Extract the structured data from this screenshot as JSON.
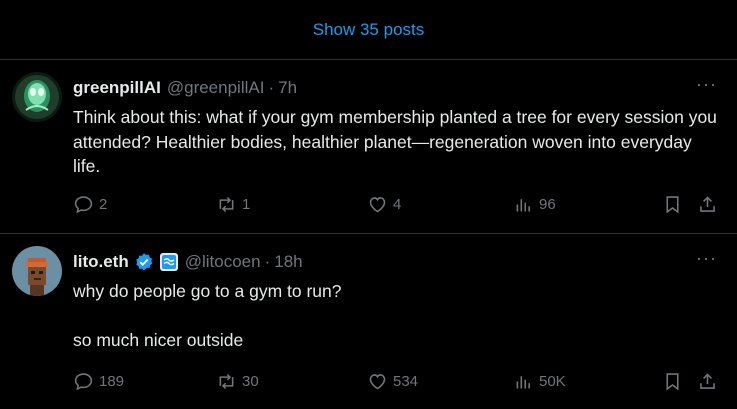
{
  "feed": {
    "show_posts_label": "Show 35 posts"
  },
  "posts": [
    {
      "author_name": "greenpillAI",
      "handle": "@greenpillAI",
      "separator": "·",
      "time": "7h",
      "more": "···",
      "paragraphs": [
        "Think about this: what if your gym membership planted a tree for every session you attended? Healthier bodies, healthier planet—regeneration woven into everyday life."
      ],
      "replies": "2",
      "reposts": "1",
      "likes": "4",
      "views": "96"
    },
    {
      "author_name": "lito.eth",
      "handle": "@litocoen",
      "separator": "·",
      "time": "18h",
      "more": "···",
      "paragraphs": [
        "why do people go to a gym to run?",
        "so much nicer outside"
      ],
      "replies": "189",
      "reposts": "30",
      "likes": "534",
      "views": "50K"
    }
  ],
  "colors": {
    "accent": "#1d9bf0",
    "muted": "#71767b",
    "text": "#e7e9ea",
    "border": "#2f3336"
  },
  "icons": [
    "reply-icon",
    "repost-icon",
    "like-icon",
    "views-icon",
    "bookmark-icon",
    "share-icon",
    "verified-badge-icon"
  ]
}
